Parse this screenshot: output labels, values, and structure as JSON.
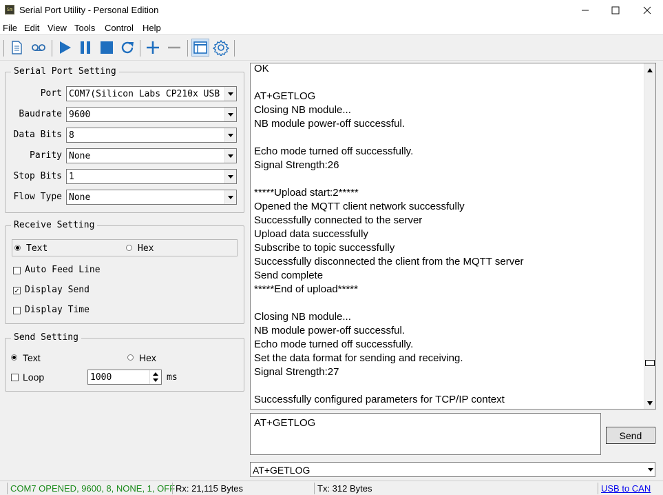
{
  "window": {
    "title": "Serial Port Utility - Personal Edition",
    "app_icon_text": "Sm"
  },
  "menu": [
    "File",
    "Edit",
    "View",
    "Tools",
    "Control",
    "Help"
  ],
  "toolbar": {
    "icons": [
      "document-icon",
      "cassette-icon",
      "play-icon",
      "pause-icon",
      "stop-icon",
      "refresh-icon",
      "plus-icon",
      "minus-icon",
      "window-icon",
      "gear-icon"
    ]
  },
  "serial_port_setting": {
    "title": "Serial Port Setting",
    "fields": [
      {
        "label": "Port",
        "value": "COM7(Silicon Labs CP210x USB"
      },
      {
        "label": "Baudrate",
        "value": "9600"
      },
      {
        "label": "Data Bits",
        "value": "8"
      },
      {
        "label": "Parity",
        "value": "None"
      },
      {
        "label": "Stop Bits",
        "value": "1"
      },
      {
        "label": "Flow Type",
        "value": "None"
      }
    ]
  },
  "receive_setting": {
    "title": "Receive Setting",
    "text_label": "Text",
    "hex_label": "Hex",
    "text_selected": true,
    "options": [
      {
        "label": "Auto Feed Line",
        "checked": false
      },
      {
        "label": "Display Send",
        "checked": true
      },
      {
        "label": "Display Time",
        "checked": false
      }
    ]
  },
  "send_setting": {
    "title": "Send Setting",
    "text_label": "Text",
    "hex_label": "Hex",
    "loop_label": "Loop",
    "loop_checked": false,
    "interval": "1000",
    "unit": "ms"
  },
  "receive_log": [
    "OK",
    "",
    "AT+GETLOG",
    "Closing NB module...",
    "NB module power-off successful.",
    "",
    "Echo mode turned off successfully.",
    "Signal Strength:26",
    "",
    "*****Upload start:2*****",
    "Opened the MQTT client network successfully",
    "Successfully connected to the server",
    "Upload data successfully",
    "Subscribe to topic successfully",
    "Successfully disconnected the client from the MQTT server",
    "Send complete",
    "*****End of upload*****",
    "",
    "Closing NB module...",
    "NB module power-off successful.",
    "Echo mode turned off successfully.",
    "Set the data format for sending and receiving.",
    "Signal Strength:27",
    "",
    "Successfully configured parameters for TCP/IP context"
  ],
  "send_area": {
    "text": "AT+GETLOG",
    "send_label": "Send"
  },
  "command_combo": {
    "value": "AT+GETLOG"
  },
  "status": {
    "port_state": "COM7 OPENED, 9600, 8, NONE, 1, OFF",
    "port_state_color": "#1a8a1a",
    "rx": "Rx: 21,115 Bytes",
    "tx": "Tx: 312 Bytes",
    "link": "USB to CAN",
    "link_color": "#0000ee"
  }
}
